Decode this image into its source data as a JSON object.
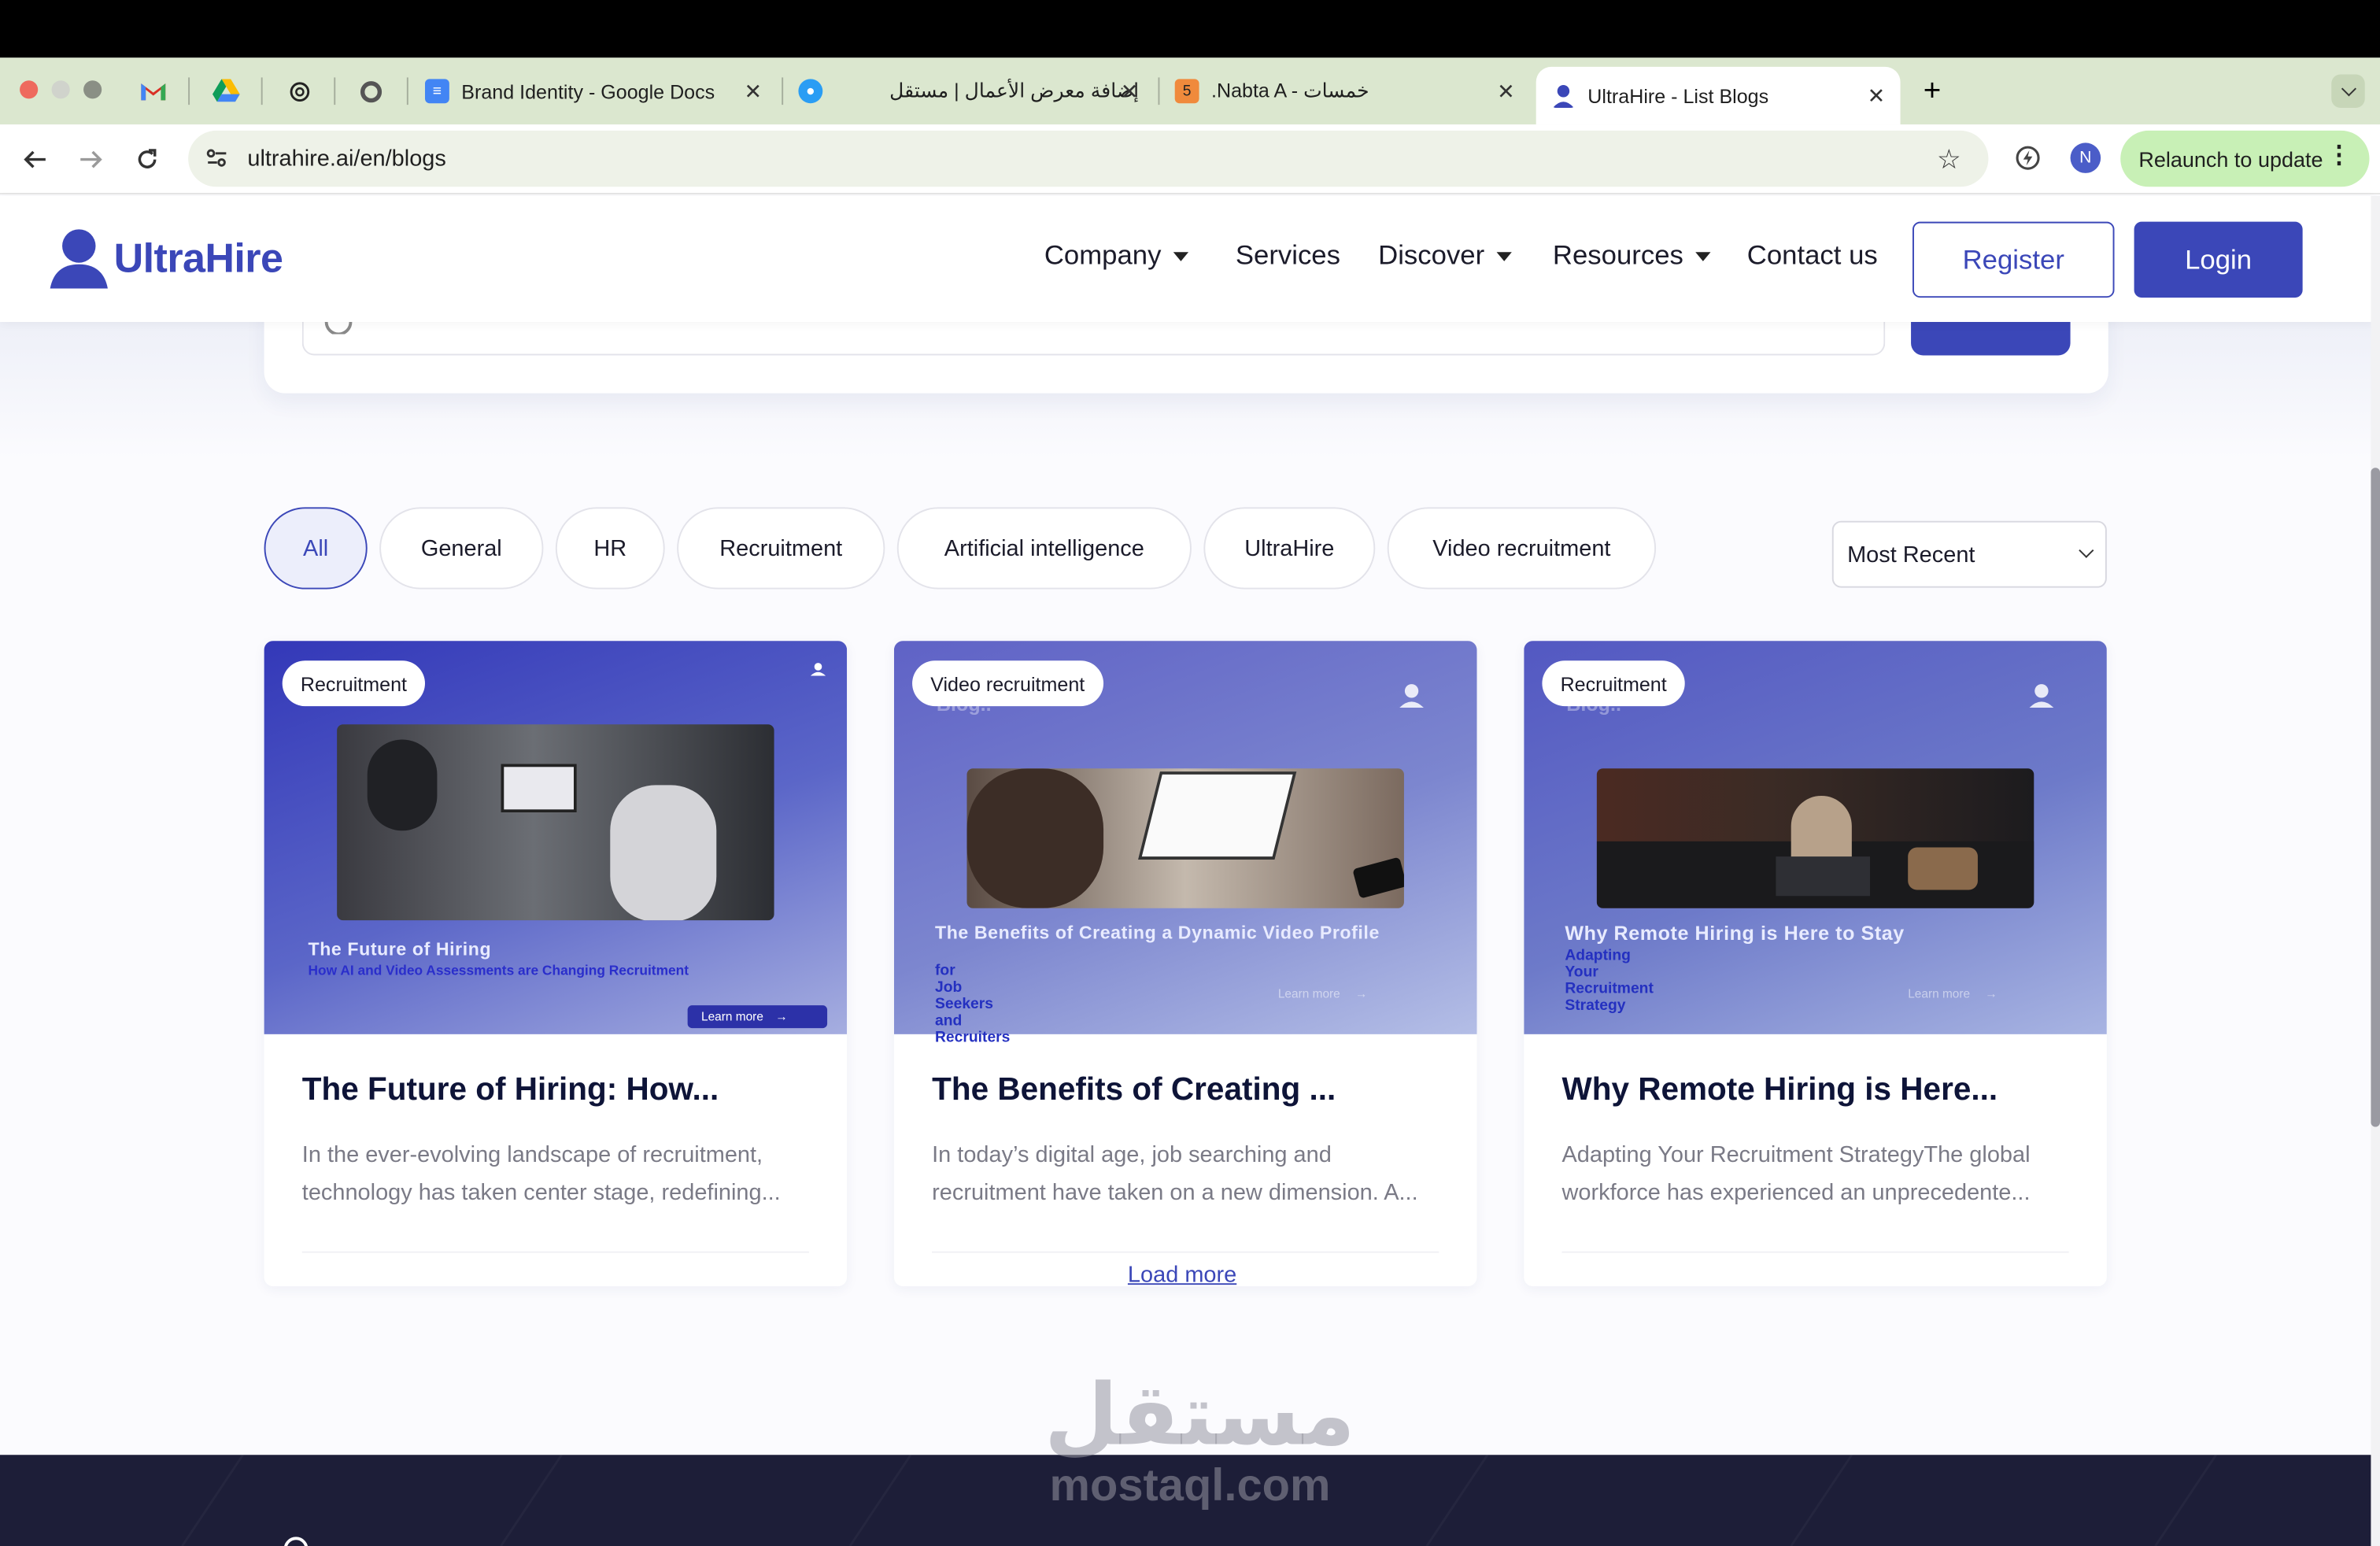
{
  "browser": {
    "tabs": [
      {
        "title": "Brand Identity - Google Docs"
      },
      {
        "title": "إضافة معرض الأعمال | مستقل"
      },
      {
        "title": ".Nabta A - خمسات"
      },
      {
        "title": "UltraHire - List Blogs"
      }
    ],
    "url": "ultrahire.ai/en/blogs",
    "relaunch_label": "Relaunch to update",
    "profile_initial": "N",
    "new_tab": "+"
  },
  "site": {
    "brand": "UltraHire",
    "nav": {
      "company": "Company",
      "services": "Services",
      "discover": "Discover",
      "resources": "Resources",
      "contact": "Contact us"
    },
    "register_label": "Register",
    "login_label": "Login"
  },
  "filters": {
    "all": "All",
    "general": "General",
    "hr": "HR",
    "recruitment": "Recruitment",
    "ai": "Artificial intelligence",
    "ultrahire": "UltraHire",
    "video": "Video recruitment",
    "sort_selected": "Most Recent"
  },
  "cards": [
    {
      "badge": "Recruitment",
      "thumb_title": "The Future of Hiring",
      "thumb_sub": "How AI and Video Assessments are Changing Recruitment",
      "thumb_cta": "Learn more",
      "title": "The Future of Hiring: How...",
      "desc": "In the ever-evolving landscape of recruitment, technology has taken center stage, redefining..."
    },
    {
      "badge": "Video recruitment",
      "thumb_title": "The Benefits of Creating a Dynamic Video Profile",
      "thumb_sub": "for Job Seekers and Recruiters",
      "thumb_cta": "Learn more",
      "thumb_brand": "Blog..",
      "title": "The Benefits of Creating ...",
      "desc": "In today’s digital age, job searching and recruitment have taken on a new dimension. A..."
    },
    {
      "badge": "Recruitment",
      "thumb_title": "Why Remote Hiring is Here to Stay",
      "thumb_sub": "Adapting Your Recruitment Strategy",
      "thumb_cta": "Learn more",
      "thumb_brand": "Blog..",
      "title": "Why Remote Hiring is Here...",
      "desc": "Adapting Your Recruitment StrategyThe global workforce has experienced an unprecedente..."
    }
  ],
  "load_more": "Load more",
  "watermark": {
    "arabic": "مستقل",
    "latin": "mostaql.com"
  },
  "colors": {
    "brand": "#3b47b8",
    "footer": "#1d1e38",
    "tabstrip": "#dbe7cf"
  }
}
